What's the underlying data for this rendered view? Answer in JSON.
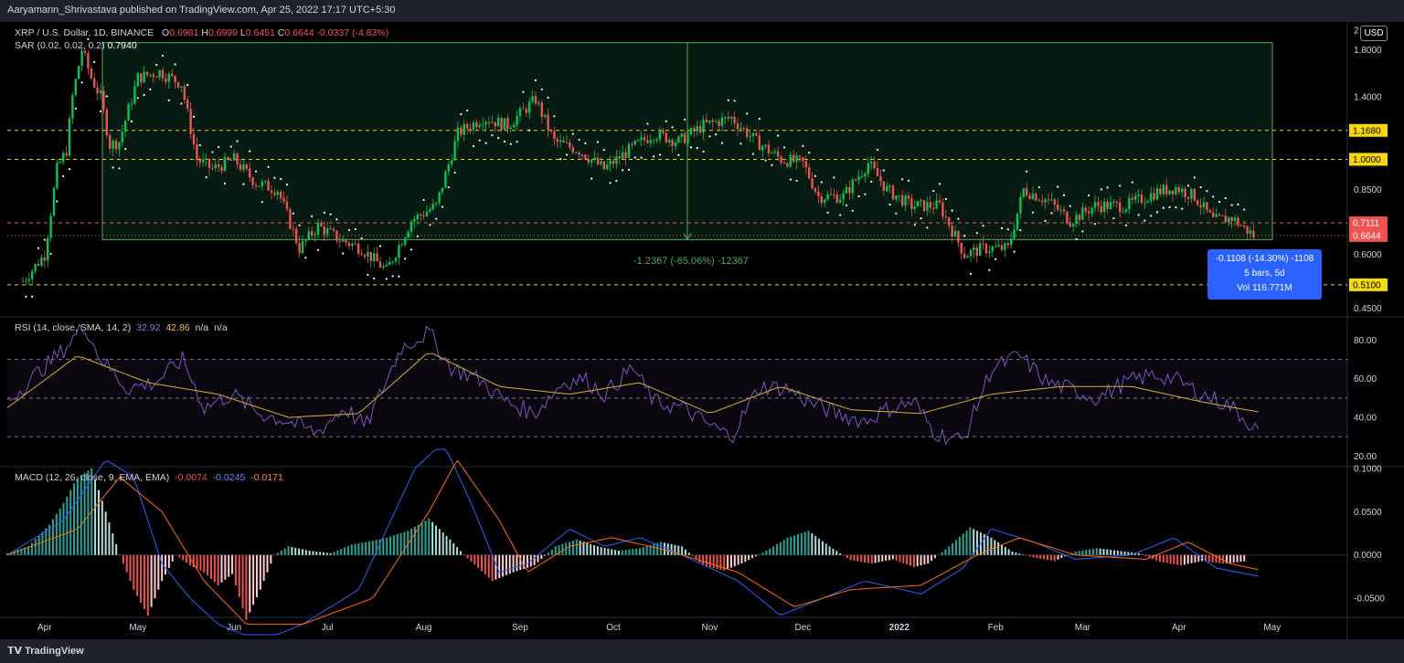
{
  "header": {
    "publish_text": "Aaryamann_Shrivastava published on TradingView.com, Apr 25, 2022 17:17 UTC+5:30"
  },
  "footer": {
    "brand": "TradingView"
  },
  "currency_button": "USD",
  "price_legend": {
    "symbol": "XRP / U.S. Dollar, 1D, BINANCE",
    "o_label": "O",
    "o_value": "0.6981",
    "h_label": "H",
    "h_value": "0.6999",
    "l_label": "L",
    "l_value": "0.6451",
    "c_label": "C",
    "c_value": "0.6644",
    "change": "-0.0337 (-4.83%)",
    "sar_label": "SAR (0.02, 0.02, 0.2)",
    "sar_value": "0.7940"
  },
  "rsi_legend": {
    "label": "RSI (14, close, SMA, 14, 2)",
    "rsi_value": "32.92",
    "sma_value": "42.86",
    "na1": "n/a",
    "na2": "n/a"
  },
  "macd_legend": {
    "label": "MACD (12, 26, close, 9, EMA, EMA)",
    "hist": "-0.0074",
    "macd": "-0.0245",
    "signal": "-0.0171"
  },
  "measure": {
    "text": "-1.2367 (-65.06%) -12367"
  },
  "info_box": {
    "line1": "-0.1108 (-14.30%) -1108",
    "line2": "5 bars, 5d",
    "line3": "Vol 116.771M"
  },
  "colors": {
    "up": "#26a69a",
    "up_bright": "#00c853",
    "down": "#ef5350",
    "yellow": "#f5d90a",
    "rsi": "#7e57c2",
    "rsi_sma": "#d4b03a",
    "macd": "#2962ff",
    "signal": "#ff6d00",
    "measure": "#4caf50"
  },
  "chart_data": [
    {
      "type": "candlestick",
      "title": "XRP / U.S. Dollar, 1D, BINANCE",
      "y_scale": "log",
      "ylim": [
        0.44,
        2.05
      ],
      "y_ticks": [
        "2",
        "1.8000",
        "1.4000",
        "1.1680",
        "1.0000",
        "0.8500",
        "0.7111",
        "0.6644",
        "0.6000",
        "0.5100",
        "0.4500"
      ],
      "x_ticks": [
        "Apr",
        "May",
        "Jun",
        "Jul",
        "Aug",
        "Sep",
        "Oct",
        "Nov",
        "Dec",
        "2022",
        "Feb",
        "Mar",
        "Apr",
        "May"
      ],
      "horizontal_levels": [
        1.168,
        1.0,
        0.51,
        0.7111
      ],
      "range_box": {
        "top": 1.87,
        "bottom": 0.65
      },
      "close_markers": {
        "last": 0.6644,
        "previous_level": 0.7111
      },
      "close_path": [
        [
          "2021-03-25",
          0.52
        ],
        [
          "2021-04-01",
          0.6
        ],
        [
          "2021-04-05",
          0.95
        ],
        [
          "2021-04-08",
          1.05
        ],
        [
          "2021-04-10",
          1.4
        ],
        [
          "2021-04-13",
          1.8
        ],
        [
          "2021-04-16",
          1.55
        ],
        [
          "2021-04-19",
          1.4
        ],
        [
          "2021-04-22",
          1.08
        ],
        [
          "2021-04-25",
          1.1
        ],
        [
          "2021-05-01",
          1.55
        ],
        [
          "2021-05-08",
          1.6
        ],
        [
          "2021-05-15",
          1.5
        ],
        [
          "2021-05-20",
          1.0
        ],
        [
          "2021-05-25",
          0.95
        ],
        [
          "2021-06-01",
          1.0
        ],
        [
          "2021-06-08",
          0.88
        ],
        [
          "2021-06-15",
          0.85
        ],
        [
          "2021-06-22",
          0.62
        ],
        [
          "2021-06-28",
          0.7
        ],
        [
          "2021-07-05",
          0.65
        ],
        [
          "2021-07-12",
          0.62
        ],
        [
          "2021-07-20",
          0.55
        ],
        [
          "2021-07-28",
          0.72
        ],
        [
          "2021-08-05",
          0.78
        ],
        [
          "2021-08-12",
          1.15
        ],
        [
          "2021-08-20",
          1.25
        ],
        [
          "2021-08-28",
          1.2
        ],
        [
          "2021-09-06",
          1.38
        ],
        [
          "2021-09-12",
          1.1
        ],
        [
          "2021-09-20",
          1.05
        ],
        [
          "2021-09-28",
          0.95
        ],
        [
          "2021-10-06",
          1.05
        ],
        [
          "2021-10-14",
          1.15
        ],
        [
          "2021-10-22",
          1.1
        ],
        [
          "2021-10-30",
          1.2
        ],
        [
          "2021-11-08",
          1.25
        ],
        [
          "2021-11-16",
          1.1
        ],
        [
          "2021-11-24",
          1.0
        ],
        [
          "2021-12-01",
          0.98
        ],
        [
          "2021-12-06",
          0.82
        ],
        [
          "2021-12-14",
          0.82
        ],
        [
          "2021-12-22",
          0.98
        ],
        [
          "2021-12-28",
          0.85
        ],
        [
          "2022-01-05",
          0.78
        ],
        [
          "2022-01-14",
          0.78
        ],
        [
          "2022-01-22",
          0.6
        ],
        [
          "2022-01-28",
          0.62
        ],
        [
          "2022-02-05",
          0.62
        ],
        [
          "2022-02-10",
          0.85
        ],
        [
          "2022-02-18",
          0.8
        ],
        [
          "2022-02-25",
          0.72
        ],
        [
          "2022-03-05",
          0.78
        ],
        [
          "2022-03-15",
          0.78
        ],
        [
          "2022-03-25",
          0.84
        ],
        [
          "2022-03-31",
          0.86
        ],
        [
          "2022-04-06",
          0.82
        ],
        [
          "2022-04-12",
          0.72
        ],
        [
          "2022-04-18",
          0.73
        ],
        [
          "2022-04-25",
          0.6644
        ]
      ]
    },
    {
      "type": "line",
      "title": "RSI (14, close, SMA, 14, 2)",
      "ylim": [
        15,
        92
      ],
      "y_ticks": [
        "80.00",
        "60.00",
        "40.00",
        "20.00"
      ],
      "bands": [
        30,
        50,
        70
      ],
      "series": [
        {
          "name": "RSI",
          "values": [
            [
              0,
              48
            ],
            [
              4,
              62
            ],
            [
              8,
              75
            ],
            [
              11,
              88
            ],
            [
              13,
              72
            ],
            [
              17,
              55
            ],
            [
              21,
              58
            ],
            [
              25,
              70
            ],
            [
              28,
              45
            ],
            [
              32,
              52
            ],
            [
              36,
              42
            ],
            [
              40,
              38
            ],
            [
              44,
              32
            ],
            [
              48,
              45
            ],
            [
              51,
              35
            ],
            [
              56,
              76
            ],
            [
              60,
              84
            ],
            [
              63,
              66
            ],
            [
              67,
              60
            ],
            [
              71,
              48
            ],
            [
              75,
              42
            ],
            [
              79,
              58
            ],
            [
              82,
              60
            ],
            [
              85,
              52
            ],
            [
              89,
              66
            ],
            [
              92,
              48
            ],
            [
              96,
              45
            ],
            [
              99,
              38
            ],
            [
              103,
              30
            ],
            [
              107,
              56
            ],
            [
              111,
              55
            ],
            [
              114,
              48
            ],
            [
              118,
              42
            ],
            [
              122,
              38
            ],
            [
              125,
              44
            ],
            [
              129,
              48
            ],
            [
              132,
              32
            ],
            [
              136,
              28
            ],
            [
              140,
              65
            ],
            [
              144,
              72
            ],
            [
              148,
              58
            ],
            [
              151,
              55
            ],
            [
              155,
              50
            ],
            [
              159,
              58
            ],
            [
              163,
              62
            ],
            [
              166,
              60
            ],
            [
              170,
              52
            ],
            [
              174,
              46
            ],
            [
              178,
              32.92
            ]
          ]
        },
        {
          "name": "SMA",
          "values": [
            [
              0,
              45
            ],
            [
              10,
              72
            ],
            [
              20,
              58
            ],
            [
              30,
              52
            ],
            [
              40,
              40
            ],
            [
              50,
              42
            ],
            [
              60,
              74
            ],
            [
              70,
              56
            ],
            [
              80,
              52
            ],
            [
              90,
              58
            ],
            [
              100,
              42
            ],
            [
              110,
              56
            ],
            [
              120,
              44
            ],
            [
              130,
              42
            ],
            [
              140,
              52
            ],
            [
              150,
              56
            ],
            [
              160,
              56
            ],
            [
              170,
              48
            ],
            [
              178,
              42.86
            ]
          ]
        }
      ]
    },
    {
      "type": "bar",
      "title": "MACD (12, 26, close, 9, EMA, EMA)",
      "ylim": [
        -0.072,
        0.102
      ],
      "y_ticks": [
        "0.1000",
        "0.0500",
        "0.0000",
        "-0.0500"
      ],
      "histogram": [
        [
          0,
          0.002
        ],
        [
          3,
          0.01
        ],
        [
          6,
          0.035
        ],
        [
          8,
          0.06
        ],
        [
          10,
          0.09
        ],
        [
          12,
          0.1
        ],
        [
          14,
          0.05
        ],
        [
          16,
          0.0
        ],
        [
          18,
          -0.04
        ],
        [
          20,
          -0.07
        ],
        [
          22,
          -0.03
        ],
        [
          24,
          0.0
        ],
        [
          26,
          -0.012
        ],
        [
          28,
          -0.02
        ],
        [
          30,
          -0.035
        ],
        [
          32,
          -0.022
        ],
        [
          34,
          -0.075
        ],
        [
          36,
          -0.04
        ],
        [
          38,
          0.0
        ],
        [
          40,
          0.01
        ],
        [
          43,
          0.005
        ],
        [
          46,
          0.002
        ],
        [
          49,
          0.012
        ],
        [
          51,
          0.015
        ],
        [
          54,
          0.02
        ],
        [
          57,
          0.028
        ],
        [
          60,
          0.042
        ],
        [
          63,
          0.018
        ],
        [
          65,
          0.0
        ],
        [
          67,
          -0.015
        ],
        [
          69,
          -0.03
        ],
        [
          72,
          -0.02
        ],
        [
          75,
          -0.012
        ],
        [
          78,
          0.01
        ],
        [
          81,
          0.018
        ],
        [
          84,
          0.01
        ],
        [
          87,
          0.005
        ],
        [
          90,
          0.008
        ],
        [
          93,
          0.015
        ],
        [
          96,
          0.01
        ],
        [
          99,
          -0.012
        ],
        [
          102,
          -0.018
        ],
        [
          105,
          -0.008
        ],
        [
          108,
          0.005
        ],
        [
          111,
          0.02
        ],
        [
          114,
          0.028
        ],
        [
          117,
          0.01
        ],
        [
          120,
          -0.006
        ],
        [
          123,
          -0.01
        ],
        [
          126,
          -0.005
        ],
        [
          129,
          -0.014
        ],
        [
          131,
          -0.01
        ],
        [
          134,
          0.01
        ],
        [
          137,
          0.032
        ],
        [
          140,
          0.02
        ],
        [
          143,
          0.004
        ],
        [
          146,
          -0.003
        ],
        [
          149,
          -0.007
        ],
        [
          152,
          0.004
        ],
        [
          155,
          0.008
        ],
        [
          158,
          0.005
        ],
        [
          161,
          0.002
        ],
        [
          164,
          -0.008
        ],
        [
          167,
          -0.012
        ],
        [
          170,
          -0.007
        ],
        [
          173,
          -0.01
        ],
        [
          176,
          -0.0074
        ]
      ],
      "series": [
        {
          "name": "MACD",
          "values": [
            [
              0,
              0.0
            ],
            [
              8,
              0.04
            ],
            [
              14,
              0.11
            ],
            [
              18,
              0.09
            ],
            [
              22,
              -0.01
            ],
            [
              26,
              -0.05
            ],
            [
              30,
              -0.08
            ],
            [
              36,
              -0.1
            ],
            [
              42,
              -0.08
            ],
            [
              50,
              -0.04
            ],
            [
              58,
              0.1
            ],
            [
              62,
              0.13
            ],
            [
              66,
              0.06
            ],
            [
              70,
              -0.02
            ],
            [
              74,
              -0.01
            ],
            [
              80,
              0.03
            ],
            [
              85,
              0.01
            ],
            [
              90,
              0.02
            ],
            [
              96,
              0.0
            ],
            [
              104,
              -0.03
            ],
            [
              110,
              -0.07
            ],
            [
              116,
              -0.05
            ],
            [
              122,
              -0.03
            ],
            [
              130,
              -0.045
            ],
            [
              136,
              -0.015
            ],
            [
              140,
              0.03
            ],
            [
              146,
              0.015
            ],
            [
              152,
              -0.005
            ],
            [
              160,
              0.0
            ],
            [
              166,
              0.02
            ],
            [
              172,
              -0.015
            ],
            [
              178,
              -0.0245
            ]
          ]
        },
        {
          "name": "Signal",
          "values": [
            [
              0,
              0.0
            ],
            [
              10,
              0.03
            ],
            [
              16,
              0.09
            ],
            [
              22,
              0.05
            ],
            [
              28,
              -0.03
            ],
            [
              34,
              -0.08
            ],
            [
              42,
              -0.08
            ],
            [
              52,
              -0.05
            ],
            [
              60,
              0.05
            ],
            [
              64,
              0.11
            ],
            [
              70,
              0.04
            ],
            [
              74,
              -0.02
            ],
            [
              80,
              0.01
            ],
            [
              86,
              0.02
            ],
            [
              94,
              0.005
            ],
            [
              104,
              -0.02
            ],
            [
              112,
              -0.06
            ],
            [
              120,
              -0.04
            ],
            [
              130,
              -0.035
            ],
            [
              138,
              0.0
            ],
            [
              144,
              0.02
            ],
            [
              152,
              0.0
            ],
            [
              162,
              -0.005
            ],
            [
              168,
              0.015
            ],
            [
              174,
              -0.01
            ],
            [
              178,
              -0.0171
            ]
          ]
        }
      ]
    }
  ]
}
